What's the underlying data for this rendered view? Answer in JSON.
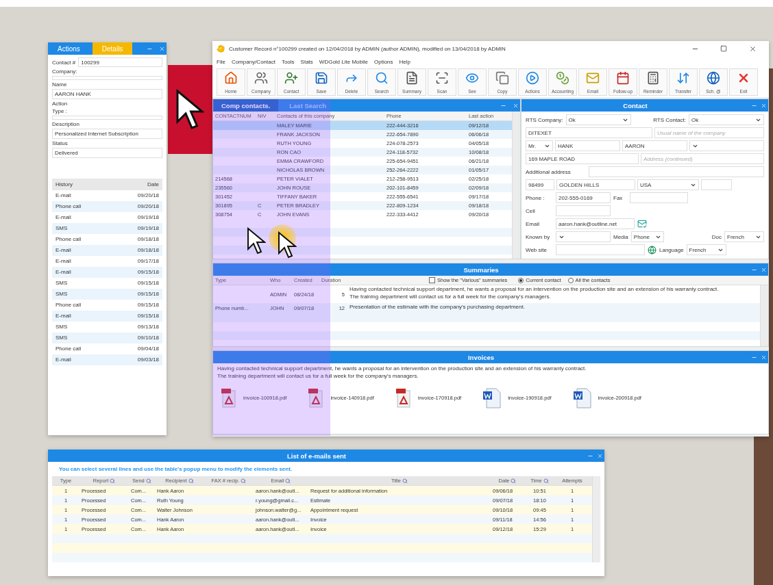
{
  "details_panel": {
    "tabs": [
      {
        "label": "Actions",
        "selected": false
      },
      {
        "label": "Details",
        "selected": true
      }
    ],
    "fields": [
      {
        "label": "Contact #",
        "value": "100299",
        "kind": "inline"
      },
      {
        "label": "Company:",
        "kind": "box"
      },
      {
        "label": "Name",
        "value": "AARON HANK",
        "kind": "box"
      },
      {
        "label": "Action",
        "kind": "label"
      },
      {
        "label": "Type :",
        "kind": "box"
      },
      {
        "label": "Description",
        "value": "Personalized Internet Subscription",
        "kind": "tall"
      },
      {
        "label": "Status",
        "value": "Delivered",
        "kind": "box"
      }
    ],
    "history": {
      "columns": [
        "History",
        "Date"
      ],
      "rows": [
        [
          "E-mail",
          "09/20/18"
        ],
        [
          "Phone call",
          "09/20/18"
        ],
        [
          "E-mail",
          "09/19/18"
        ],
        [
          "SMS",
          "09/19/18"
        ],
        [
          "Phone call",
          "09/18/18"
        ],
        [
          "E-mail",
          "09/18/18"
        ],
        [
          "E-mail",
          "09/17/18"
        ],
        [
          "E-mail",
          "09/15/18"
        ],
        [
          "SMS",
          "09/15/18"
        ],
        [
          "SMS",
          "09/15/18"
        ],
        [
          "Phone call",
          "09/15/18"
        ],
        [
          "E-mail",
          "09/15/18"
        ],
        [
          "SMS",
          "09/13/18"
        ],
        [
          "SMS",
          "09/10/18"
        ],
        [
          "Phone call",
          "09/04/18"
        ],
        [
          "E-mail",
          "09/03/18"
        ]
      ]
    }
  },
  "main_window": {
    "title": "Customer Record n°100299 created on 12/04/2018 by ADMIN (author ADMIN), modified on 13/04/2018 by ADMIN",
    "menu": [
      "File",
      "Company/Contact",
      "Tools",
      "Stats",
      "WDGold Lite Mobile",
      "Options",
      "Help"
    ],
    "toolbar": [
      "Home",
      "Company",
      "Contact",
      "Save",
      "Delete",
      "Search",
      "Summary",
      "Scan",
      "See",
      "Copy",
      "Actions",
      "Accounting",
      "Email",
      "Follow-up",
      "Reminder",
      "Transfer",
      "Sch. @",
      "Exit"
    ]
  },
  "contacts": {
    "tabs": [
      {
        "label": "Comp contacts.",
        "selected": true
      },
      {
        "label": "Last Search",
        "selected": false
      }
    ],
    "columns": [
      "CONTACTNUM",
      "NIV",
      "Contacts of this company",
      "Phone",
      "Last action"
    ],
    "rows": [
      {
        "cells": [
          "",
          "",
          "MALEY MARIE",
          "222-444-3216",
          "09/12/18"
        ],
        "selected": true
      },
      {
        "cells": [
          "",
          "",
          "FRANK JACKSON",
          "222-654-7890",
          "06/06/18"
        ],
        "selected": false
      },
      {
        "cells": [
          "",
          "",
          "RUTH YOUNG",
          "224-078-2573",
          "04/05/18"
        ],
        "selected": false
      },
      {
        "cells": [
          "",
          "",
          "RON CAO",
          "224-118-5732",
          "10/08/18"
        ],
        "selected": false
      },
      {
        "cells": [
          "",
          "",
          "EMMA CRAWFORD",
          "225-654-9451",
          "06/21/18"
        ],
        "selected": false
      },
      {
        "cells": [
          "",
          "",
          "NICHOLAS BROWN",
          "252-264-2222",
          "01/05/17"
        ],
        "selected": false
      },
      {
        "cells": [
          "214568",
          "",
          "PETER VIALET",
          "212-258-9513",
          "02/25/18"
        ],
        "selected": false
      },
      {
        "cells": [
          "235560",
          "",
          "JOHN ROUSE",
          "202-101-8459",
          "02/09/18"
        ],
        "selected": false
      },
      {
        "cells": [
          "301452",
          "",
          "TIFFANY BAKER",
          "222-555-6541",
          "09/17/18"
        ],
        "selected": false
      },
      {
        "cells": [
          "301895",
          "C",
          "PETER BRADLEY",
          "222-809-1234",
          "09/18/18"
        ],
        "selected": false
      },
      {
        "cells": [
          "308754",
          "C",
          "JOHN EVANS",
          "222-333-4412",
          "09/20/18"
        ],
        "selected": false
      }
    ]
  },
  "contact": {
    "title": "Contact",
    "rts_company": {
      "label": "RTS Company:",
      "value": "Ok"
    },
    "rts_contact": {
      "label": "RTS Contact:",
      "value": "Ok"
    },
    "company": {
      "value": "DITEXET"
    },
    "usual_name": {
      "placeholder": "Usual name of the company"
    },
    "civility": {
      "value": "Mr."
    },
    "last_name": {
      "value": "HANK"
    },
    "first_name": {
      "value": "AARON"
    },
    "address": {
      "value": "169 MAPLE ROAD"
    },
    "address2": {
      "placeholder": "Address (continued)"
    },
    "additional": {
      "label": "Additional address"
    },
    "zip": {
      "value": "98499"
    },
    "city": {
      "value": "GOLDEN HILLS"
    },
    "country": {
      "value": "USA"
    },
    "phone": {
      "label": "Phone :",
      "value": "202-555-0169"
    },
    "fax": {
      "label": "Fax"
    },
    "cell": {
      "label": "Cell"
    },
    "email": {
      "label": "Email",
      "value": "aaron.hank@outline.net"
    },
    "known_by": {
      "label": "Known by"
    },
    "media": {
      "label": "Media",
      "value": "Phone"
    },
    "doc": {
      "label": "Doc",
      "value": "French"
    },
    "website": {
      "label": "Web site"
    },
    "language": {
      "label": "Language",
      "value": "French"
    }
  },
  "summaries": {
    "title": "Summaries",
    "columns": [
      "Type",
      "Who",
      "Created",
      "Duration"
    ],
    "show_various": {
      "label": "Show the \"Various\" summaries",
      "checked": false
    },
    "scope": [
      {
        "label": "Current contact",
        "selected": true
      },
      {
        "label": "All the contacts",
        "selected": false
      }
    ],
    "rows": [
      {
        "type": "",
        "who": "ADMIN",
        "created": "08/24/18",
        "duration": "5",
        "text": [
          "Having contacted technical support department, he wants a proposal for an intervention on the production site and an extension of his warranty contract.",
          "The training department will contact us for a full week for the company's managers."
        ]
      },
      {
        "type": "Phone numb...",
        "who": "JOHN",
        "created": "09/07/18",
        "duration": "12",
        "text": [
          "Presentation of the estimate with the company's purchasing department."
        ]
      }
    ]
  },
  "invoices": {
    "title": "Invoices",
    "text": [
      "Having contacted technical support department, he wants a proposal for an intervention on the production site and an extension of his warranty contract.",
      "The training department will contact us for a full week for the company's managers."
    ],
    "files": [
      {
        "name": "invoice-100918.pdf",
        "kind": "pdf"
      },
      {
        "name": "invoice-140918.pdf",
        "kind": "pdf"
      },
      {
        "name": "invoice-170918.pdf",
        "kind": "pdf"
      },
      {
        "name": "invoice-190918.pdf",
        "kind": "word"
      },
      {
        "name": "invoice-200918.pdf",
        "kind": "word"
      }
    ]
  },
  "emails": {
    "title": "List of e-mails sent",
    "hint": "You can select several lines and use the table's popup menu to modify the elements sent.",
    "columns": [
      {
        "label": "Type",
        "filter": false
      },
      {
        "label": "Report",
        "filter": true
      },
      {
        "label": "Send",
        "filter": true
      },
      {
        "label": "Recipient",
        "filter": true
      },
      {
        "label": "FAX # recip.",
        "filter": true
      },
      {
        "label": "Email",
        "filter": true
      },
      {
        "label": "Title",
        "filter": true
      },
      {
        "label": "Date",
        "filter": true
      },
      {
        "label": "Time",
        "filter": true
      },
      {
        "label": "Attempts",
        "filter": false
      }
    ],
    "rows": [
      [
        "1",
        "Processed",
        "Com...",
        "Hank Aaron",
        "",
        "aaron.hank@outl...",
        "Request for additional information",
        "09/06/18",
        "10:51",
        "1"
      ],
      [
        "1",
        "Processed",
        "Com...",
        "Ruth Young",
        "",
        "r.young@gmail.c...",
        "Estimate",
        "09/07/18",
        "18:10",
        "1"
      ],
      [
        "1",
        "Processed",
        "Com...",
        "Walter Johnson",
        "",
        "johnson.walter@g...",
        "Appointment request",
        "09/10/18",
        "09:45",
        "1"
      ],
      [
        "1",
        "Processed",
        "Com...",
        "Hank Aaron",
        "",
        "aaron.hank@outl...",
        "Invoice",
        "09/11/18",
        "14:56",
        "1"
      ],
      [
        "1",
        "Processed",
        "Com...",
        "Hank Aaron",
        "",
        "aaron.hank@outl...",
        "Invoice",
        "09/12/18",
        "15:29",
        "1"
      ]
    ]
  }
}
